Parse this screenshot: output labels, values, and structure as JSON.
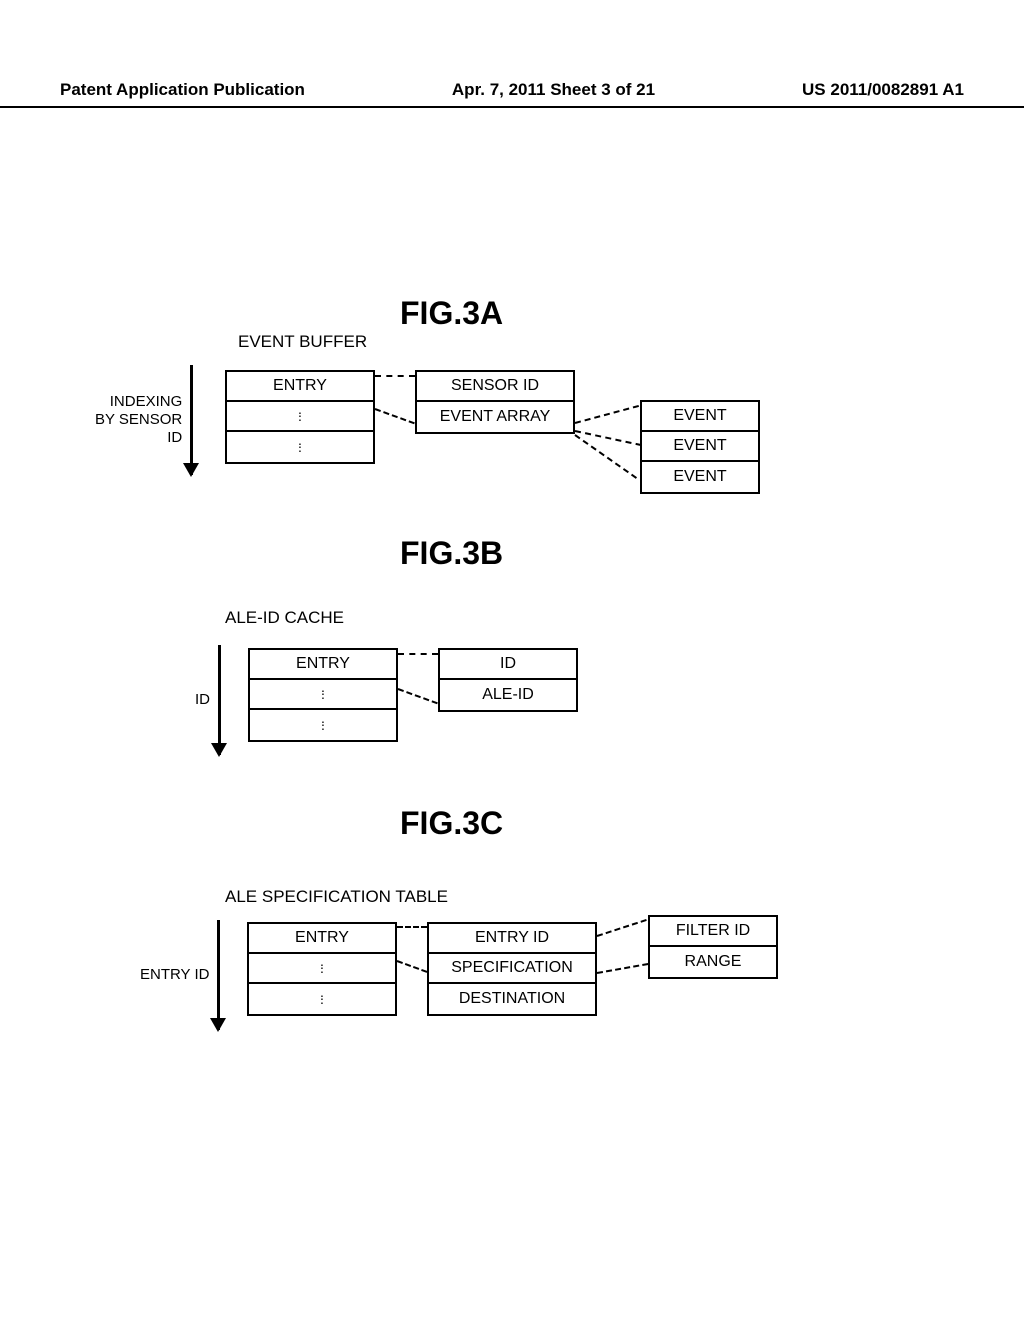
{
  "header": {
    "left": "Patent Application Publication",
    "center": "Apr. 7, 2011  Sheet 3 of 21",
    "right": "US 2011/0082891 A1"
  },
  "figA": {
    "title": "FIG.3A",
    "subtitle": "EVENT BUFFER",
    "arrow_label": "INDEXING\nBY SENSOR\nID",
    "col1": {
      "r0": "ENTRY"
    },
    "col2": {
      "r0": "SENSOR ID",
      "r1": "EVENT ARRAY"
    },
    "col3": {
      "r0": "EVENT",
      "r1": "EVENT",
      "r2": "EVENT"
    }
  },
  "figB": {
    "title": "FIG.3B",
    "subtitle": "ALE-ID CACHE",
    "arrow_label": "ID",
    "col1": {
      "r0": "ENTRY"
    },
    "col2": {
      "r0": "ID",
      "r1": "ALE-ID"
    }
  },
  "figC": {
    "title": "FIG.3C",
    "subtitle": "ALE SPECIFICATION TABLE",
    "arrow_label": "ENTRY ID",
    "col1": {
      "r0": "ENTRY"
    },
    "col2": {
      "r0": "ENTRY ID",
      "r1": "SPECIFICATION",
      "r2": "DESTINATION"
    },
    "col3": {
      "r0": "FILTER ID",
      "r1": "RANGE"
    }
  }
}
